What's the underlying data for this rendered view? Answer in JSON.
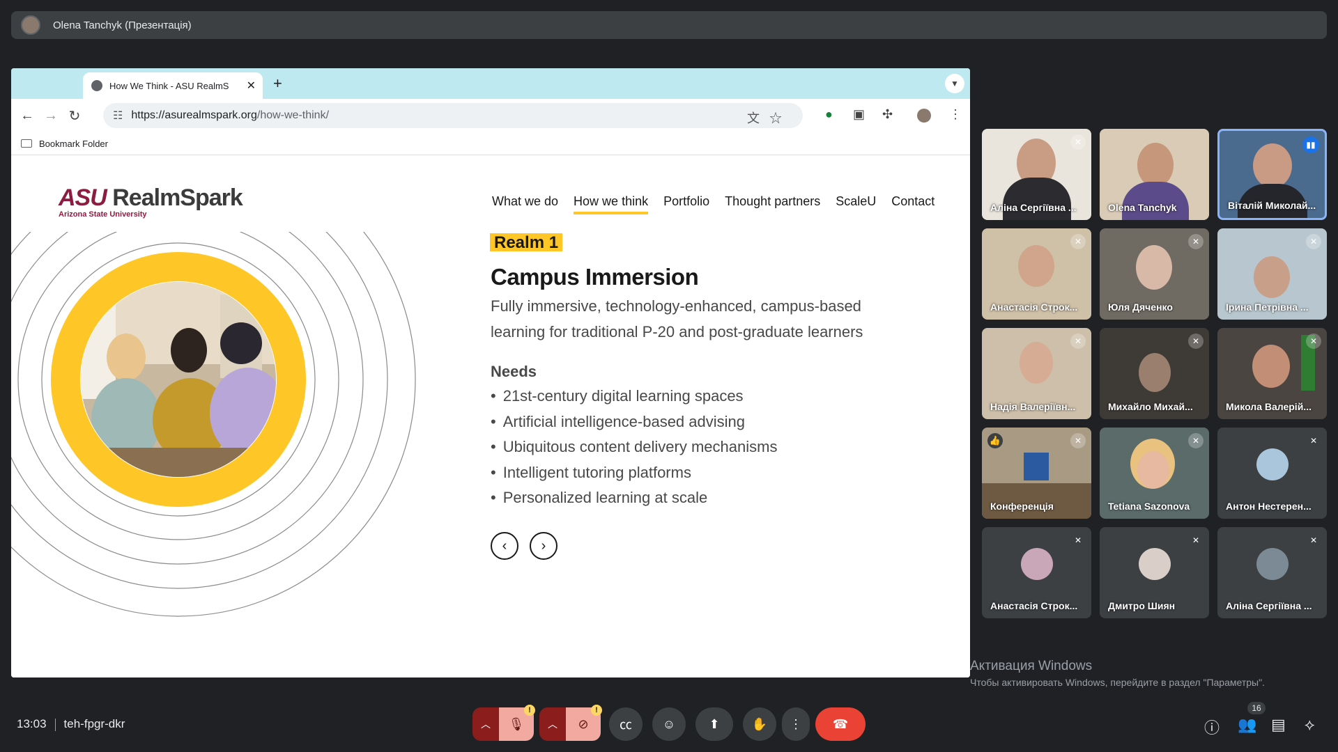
{
  "top_banner": {
    "title": "Olena Tanchyk (Презентація)"
  },
  "browser": {
    "tab_title": "How We Think - ASU RealmS",
    "new_tab": "+",
    "url_host": "https://asurealmspark.org",
    "url_path": "/how-we-think/",
    "bookmark_folder": "Bookmark Folder"
  },
  "site": {
    "logo_main": "RealmSpark",
    "logo_asu": "ASU",
    "logo_sub": "Arizona State University",
    "nav": [
      "What we do",
      "How we think",
      "Portfolio",
      "Thought partners",
      "ScaleU",
      "Contact"
    ],
    "realm_badge": "Realm 1",
    "heading": "Campus Immersion",
    "description": "Fully immersive, technology-enhanced, campus-based learning for traditional P-20 and post-graduate learners",
    "needs_label": "Needs",
    "needs": [
      "21st-century digital learning spaces",
      "Artificial intelligence-based advising",
      "Ubiquitous content delivery mechanisms",
      "Intelligent tutoring platforms",
      "Personalized learning at scale"
    ],
    "accent_color": "#ffc627"
  },
  "participants": [
    {
      "name": "Аліна Сергіївна ..."
    },
    {
      "name": "Olena Tanchyk"
    },
    {
      "name": "Віталій Миколай..."
    },
    {
      "name": "Анастасія Строк..."
    },
    {
      "name": "Юля Дяченко"
    },
    {
      "name": "Ірина Петрівна ..."
    },
    {
      "name": "Надія Валеріївн..."
    },
    {
      "name": "Михайло Михай..."
    },
    {
      "name": "Микола Валерій..."
    },
    {
      "name": "Конференція"
    },
    {
      "name": "Tetiana Sazonova"
    },
    {
      "name": "Антон Нестерен..."
    },
    {
      "name": "Анастасія Строк..."
    },
    {
      "name": "Дмитро Шиян"
    },
    {
      "name": "Аліна Сергіївна ..."
    }
  ],
  "windows_activation": {
    "line1": "Активация Windows",
    "line2": "Чтобы активировать Windows, перейдите в раздел \"Параметры\"."
  },
  "bottom_bar": {
    "time": "13:03",
    "meeting_code": "teh-fpgr-dkr",
    "participants_count": "16",
    "warning": "!"
  }
}
